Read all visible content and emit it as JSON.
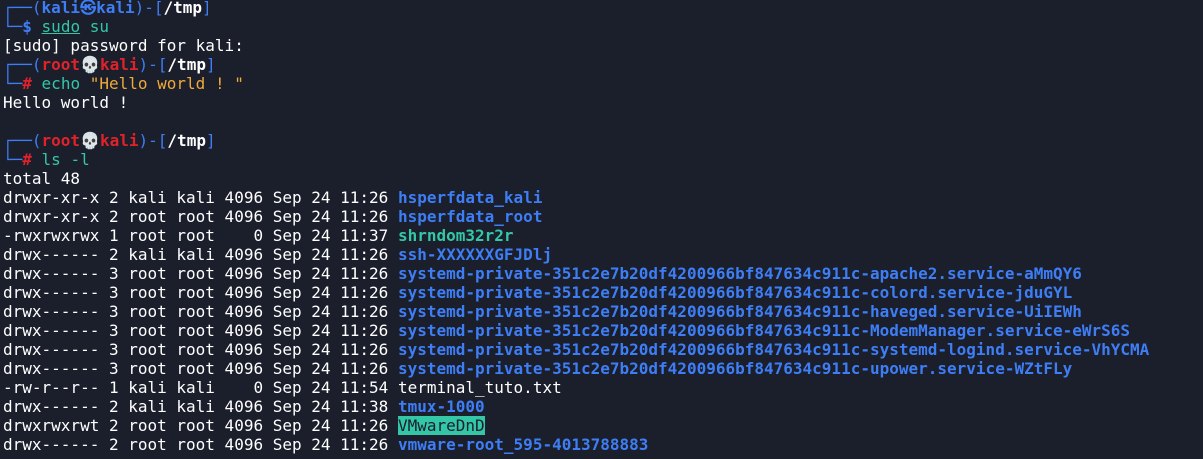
{
  "colors": {
    "background": "#1b1e2b",
    "blue": "#3e7ef5",
    "red": "#e0232b",
    "green": "#33c7a8",
    "orange": "#f0a93a",
    "white": "#ffffff"
  },
  "prompt1": {
    "corner_top": "┌──(",
    "user": "kali",
    "symbol": "㉿",
    "host": "kali",
    "sep": ")-[",
    "path": "/tmp",
    "close": "]",
    "corner_bottom": "└─",
    "sigil": "$",
    "command": "sudo",
    "args": "su"
  },
  "sudo_prompt": "[sudo] password for kali:",
  "prompt2": {
    "corner_top": "┌──(",
    "user": "root",
    "symbol": "💀",
    "host": "kali",
    "sep": ")-[",
    "path": "/tmp",
    "close": "]",
    "corner_bottom": "└─",
    "sigil": "#",
    "command": "echo",
    "args": "\"Hello world ! \""
  },
  "echo_output": "Hello world !",
  "prompt3": {
    "corner_top": "┌──(",
    "user": "root",
    "symbol": "💀",
    "host": "kali",
    "sep": ")-[",
    "path": "/tmp",
    "close": "]",
    "corner_bottom": "└─",
    "sigil": "#",
    "command": "ls",
    "args": "-l"
  },
  "total": "total 48",
  "listing": [
    {
      "meta": "drwxr-xr-x 2 kali kali 4096 Sep 24 11:26 ",
      "name": "hsperfdata_kali",
      "kind": "dir"
    },
    {
      "meta": "drwxr-xr-x 2 root root 4096 Sep 24 11:26 ",
      "name": "hsperfdata_root",
      "kind": "dir"
    },
    {
      "meta": "-rwxrwxrwx 1 root root    0 Sep 24 11:37 ",
      "name": "shrndom32r2r",
      "kind": "exec"
    },
    {
      "meta": "drwx------ 2 kali kali 4096 Sep 24 11:26 ",
      "name": "ssh-XXXXXXGFJDlj",
      "kind": "dir"
    },
    {
      "meta": "drwx------ 3 root root 4096 Sep 24 11:26 ",
      "name": "systemd-private-351c2e7b20df4200966bf847634c911c-apache2.service-aMmQY6",
      "kind": "dir"
    },
    {
      "meta": "drwx------ 3 root root 4096 Sep 24 11:26 ",
      "name": "systemd-private-351c2e7b20df4200966bf847634c911c-colord.service-jduGYL",
      "kind": "dir"
    },
    {
      "meta": "drwx------ 3 root root 4096 Sep 24 11:26 ",
      "name": "systemd-private-351c2e7b20df4200966bf847634c911c-haveged.service-UiIEWh",
      "kind": "dir"
    },
    {
      "meta": "drwx------ 3 root root 4096 Sep 24 11:26 ",
      "name": "systemd-private-351c2e7b20df4200966bf847634c911c-ModemManager.service-eWrS6S",
      "kind": "dir"
    },
    {
      "meta": "drwx------ 3 root root 4096 Sep 24 11:26 ",
      "name": "systemd-private-351c2e7b20df4200966bf847634c911c-systemd-logind.service-VhYCMA",
      "kind": "dir"
    },
    {
      "meta": "drwx------ 3 root root 4096 Sep 24 11:26 ",
      "name": "systemd-private-351c2e7b20df4200966bf847634c911c-upower.service-WZtFLy",
      "kind": "dir"
    },
    {
      "meta": "-rw-r--r-- 1 kali kali    0 Sep 24 11:54 ",
      "name": "terminal_tuto.txt",
      "kind": "file"
    },
    {
      "meta": "drwx------ 2 kali kali 4096 Sep 24 11:38 ",
      "name": "tmux-1000",
      "kind": "dir"
    },
    {
      "meta": "drwxrwxrwt 2 root root 4096 Sep 24 11:26 ",
      "name": "VMwareDnD",
      "kind": "sticky"
    },
    {
      "meta": "drwx------ 2 root root 4096 Sep 24 11:26 ",
      "name": "vmware-root_595-4013788883",
      "kind": "dir"
    }
  ]
}
